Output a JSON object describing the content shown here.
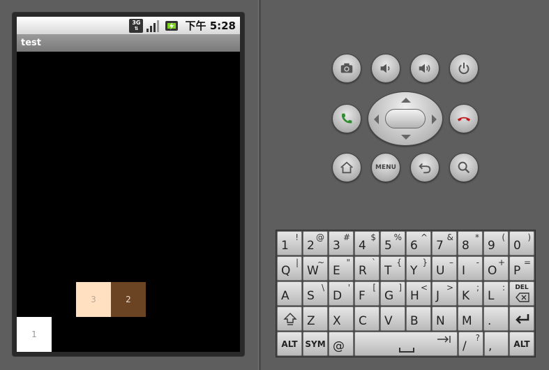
{
  "status_bar": {
    "network_label": "3G",
    "time_prefix": "下午",
    "time": "5:28"
  },
  "app": {
    "title": "test",
    "tiles": [
      {
        "label": "1",
        "color": "#ffffff"
      },
      {
        "label": "3",
        "color": "#ffe0c0"
      },
      {
        "label": "2",
        "color": "#6b4424"
      }
    ]
  },
  "controls": {
    "top_row_icons": [
      "camera-icon",
      "volume-down-icon",
      "volume-up-icon",
      "power-icon"
    ],
    "call_icon": "call-icon",
    "end_call_icon": "end-call-icon",
    "bottom_row_icons": [
      "home-icon",
      "menu-icon",
      "back-icon",
      "search-icon"
    ],
    "menu_label": "MENU"
  },
  "keyboard": {
    "row1": [
      {
        "main": "1",
        "alt": "!"
      },
      {
        "main": "2",
        "alt": "@"
      },
      {
        "main": "3",
        "alt": "#"
      },
      {
        "main": "4",
        "alt": "$"
      },
      {
        "main": "5",
        "alt": "%"
      },
      {
        "main": "6",
        "alt": "^"
      },
      {
        "main": "7",
        "alt": "&"
      },
      {
        "main": "8",
        "alt": "*"
      },
      {
        "main": "9",
        "alt": "("
      },
      {
        "main": "0",
        "alt": ")"
      }
    ],
    "row2": [
      {
        "main": "Q",
        "alt": "|"
      },
      {
        "main": "W",
        "alt": "~"
      },
      {
        "main": "E",
        "alt": "\""
      },
      {
        "main": "R",
        "alt": "`"
      },
      {
        "main": "T",
        "alt": "{"
      },
      {
        "main": "Y",
        "alt": "}"
      },
      {
        "main": "U",
        "alt": "–"
      },
      {
        "main": "I",
        "alt": "-"
      },
      {
        "main": "O",
        "alt": "+"
      },
      {
        "main": "P",
        "alt": "="
      }
    ],
    "row3": [
      {
        "main": "A",
        "alt": ""
      },
      {
        "main": "S",
        "alt": "\\"
      },
      {
        "main": "D",
        "alt": "'"
      },
      {
        "main": "F",
        "alt": "["
      },
      {
        "main": "G",
        "alt": "]"
      },
      {
        "main": "H",
        "alt": "<"
      },
      {
        "main": "J",
        "alt": ">"
      },
      {
        "main": "K",
        "alt": ";"
      },
      {
        "main": "L",
        "alt": ":"
      }
    ],
    "del_label": "DEL",
    "row4": [
      {
        "main": "Z",
        "alt": ""
      },
      {
        "main": "X",
        "alt": ""
      },
      {
        "main": "C",
        "alt": ""
      },
      {
        "main": "V",
        "alt": ""
      },
      {
        "main": "B",
        "alt": ""
      },
      {
        "main": "N",
        "alt": ""
      },
      {
        "main": "M",
        "alt": ""
      },
      {
        "main": ".",
        "alt": ""
      }
    ],
    "alt_left": "ALT",
    "sym": "SYM",
    "at": "@",
    "slash": {
      "main": "/",
      "alt": "?"
    },
    "comma": ",",
    "alt_right": "ALT"
  }
}
